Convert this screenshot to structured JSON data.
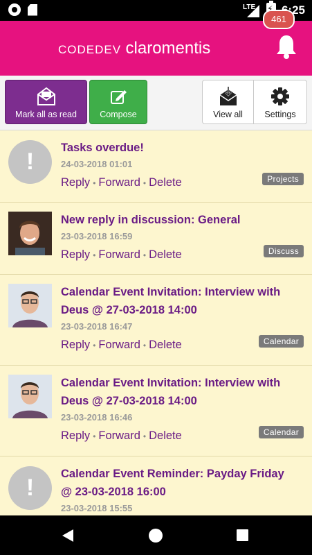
{
  "status_bar": {
    "network": "LTE",
    "time": "6:25"
  },
  "header": {
    "logo_part1": "CODEDEV",
    "logo_part2": "claromentis",
    "notification_count": "461"
  },
  "toolbar": {
    "mark_all_label": "Mark all as read",
    "compose_label": "Compose",
    "view_all_label": "View all",
    "settings_label": "Settings"
  },
  "actions": {
    "reply": "Reply",
    "forward": "Forward",
    "delete": "Delete",
    "separator": "•"
  },
  "notifications": [
    {
      "avatar": "alert-icon",
      "title": "Tasks overdue!",
      "date": "24-03-2018 01:01",
      "tag": "Projects"
    },
    {
      "avatar": "user-photo",
      "title": "New reply in discussion: General",
      "date": "23-03-2018 16:59",
      "tag": "Discuss"
    },
    {
      "avatar": "user-photo",
      "title": "Calendar Event Invitation: Interview with Deus @ 27-03-2018 14:00",
      "date": "23-03-2018 16:47",
      "tag": "Calendar"
    },
    {
      "avatar": "user-photo",
      "title": "Calendar Event Invitation: Interview with Deus @ 27-03-2018 14:00",
      "date": "23-03-2018 16:46",
      "tag": "Calendar"
    },
    {
      "avatar": "alert-icon",
      "title": "Calendar Event Reminder: Payday Friday @ 23-03-2018 16:00",
      "date": "23-03-2018 15:55",
      "tag": ""
    }
  ],
  "colors": {
    "brand": "#e6127f",
    "purple": "#7d2d8f",
    "green": "#3fae49",
    "list_bg": "#fdf6cf",
    "title": "#6a1b85",
    "badge": "#d9534f"
  }
}
